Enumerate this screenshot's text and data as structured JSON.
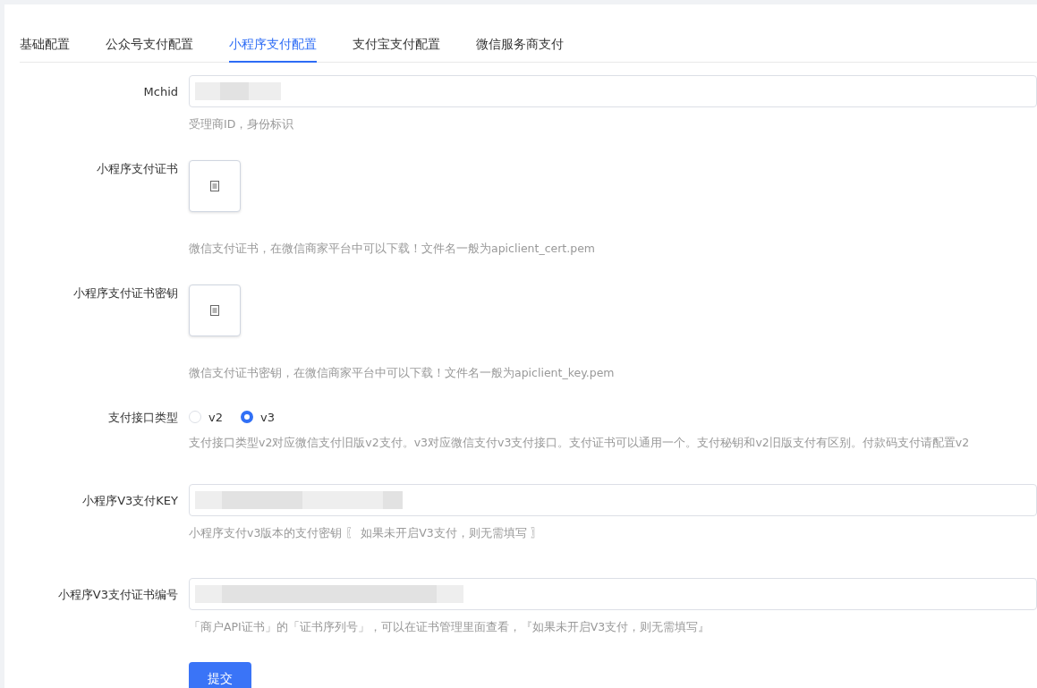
{
  "tabs": [
    {
      "label": "基础配置",
      "selected": false
    },
    {
      "label": "公众号支付配置",
      "selected": false
    },
    {
      "label": "小程序支付配置",
      "selected": true
    },
    {
      "label": "支付宝支付配置",
      "selected": false
    },
    {
      "label": "微信服务商支付",
      "selected": false
    }
  ],
  "fields": [
    {
      "kind": "input",
      "label": "Mchid",
      "help": "受理商ID，身份标识"
    },
    {
      "kind": "upload",
      "label": "小程序支付证书",
      "help": "微信支付证书，在微信商家平台中可以下载！文件名一般为apiclient_cert.pem"
    },
    {
      "kind": "upload",
      "label": "小程序支付证书密钥",
      "help": "微信支付证书密钥，在微信商家平台中可以下载！文件名一般为apiclient_key.pem"
    },
    {
      "kind": "radio",
      "label": "支付接口类型",
      "options": [
        {
          "label": "v2",
          "selected": false
        },
        {
          "label": "v3",
          "selected": true
        }
      ],
      "help": "支付接口类型v2对应微信支付旧版v2支付。v3对应微信支付v3支付接口。支付证书可以通用一个。支付秘钥和v2旧版支付有区别。付款码支付请配置v2"
    },
    {
      "kind": "input",
      "label": "小程序V3支付KEY",
      "help": "小程序支付v3版本的支付密钥 〖 如果未开启V3支付，则无需填写 〗"
    },
    {
      "kind": "input",
      "label": "小程序V3支付证书编号",
      "help": "「商户API证书」的「证书序列号」，可以在证书管理里面查看，『如果未开启V3支付，则无需填写』"
    }
  ],
  "submit": "提交"
}
